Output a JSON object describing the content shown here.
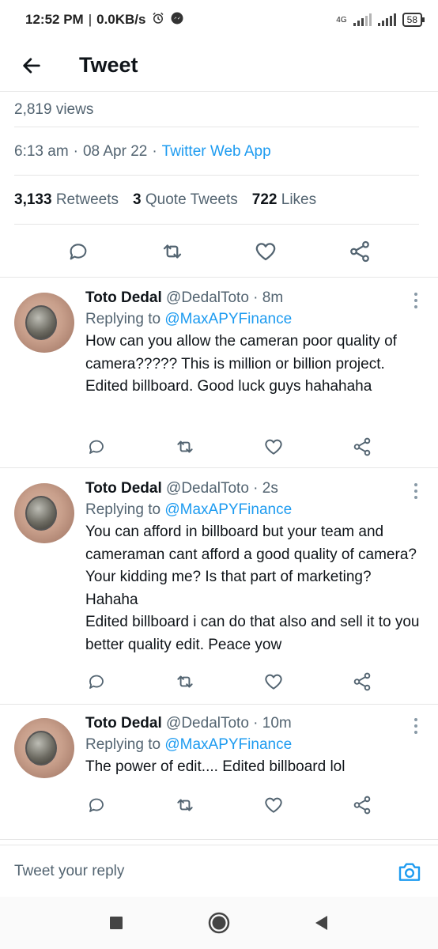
{
  "status_bar": {
    "time": "12:52 PM",
    "speed": "0.0KB/s",
    "network": "4G",
    "battery": "58"
  },
  "header": {
    "title": "Tweet"
  },
  "tweet": {
    "views": "2,819 views",
    "time": "6:13 am",
    "date": "08 Apr 22",
    "source": "Twitter Web App",
    "retweets_count": "3,133",
    "retweets_label": "Retweets",
    "quotes_count": "3",
    "quotes_label": "Quote Tweets",
    "likes_count": "722",
    "likes_label": "Likes"
  },
  "replies": [
    {
      "name": "Toto Dedal",
      "handle": "@DedalToto",
      "time": "8m",
      "replying_prefix": "Replying to",
      "replying_to": "@MaxAPYFinance",
      "text": "How can you allow the cameran poor quality of camera????? This is million or billion project. Edited  billboard. Good luck guys hahahaha"
    },
    {
      "name": "Toto Dedal",
      "handle": "@DedalToto",
      "time": "2s",
      "replying_prefix": "Replying to",
      "replying_to": "@MaxAPYFinance",
      "text": "You can afford in billboard but your team and cameraman cant afford a good quality of camera? Your kidding me? Is that part of marketing? Hahaha\nEdited billboard i can do that also and sell it to you better quality edit. Peace yow"
    },
    {
      "name": "Toto Dedal",
      "handle": "@DedalToto",
      "time": "10m",
      "replying_prefix": "Replying to",
      "replying_to": "@MaxAPYFinance",
      "text": "The power of edit.... Edited billboard lol"
    }
  ],
  "compose": {
    "placeholder": "Tweet your reply"
  },
  "colors": {
    "accent": "#1d9bf0",
    "muted": "#536471",
    "text": "#0f1419"
  }
}
